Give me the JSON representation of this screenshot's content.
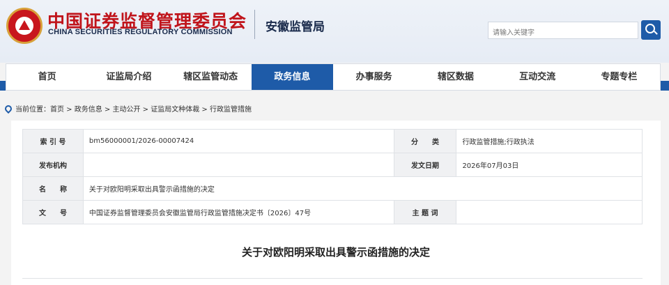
{
  "header": {
    "logo_cn": "中国证券监督管理委员会",
    "logo_en": "CHINA SECURITIES REGULATORY COMMISSION",
    "bureau": "安徽监管局",
    "search_placeholder": "请输入关键字"
  },
  "nav": {
    "items": [
      "首页",
      "证监局介绍",
      "辖区监管动态",
      "政务信息",
      "办事服务",
      "辖区数据",
      "互动交流",
      "专题专栏"
    ],
    "active": "政务信息"
  },
  "breadcrumb": "当前位置：首页 > 政务信息 > 主动公开 > 证监局文种体裁 > 行政监管措施",
  "meta": {
    "index_label": "索 引 号",
    "index_value": "bm56000001/2026-00007424",
    "category_label": "分　　类",
    "category_value": "行政监管措施;行政执法",
    "publisher_label": "发布机构",
    "publisher_value": "",
    "date_label": "发文日期",
    "date_value": "2026年07月03日",
    "name_label": "名　　称",
    "name_value": "关于对欧阳明采取出具警示函措施的决定",
    "docno_label": "文　　号",
    "docno_value": "中国证券监督管理委员会安徽监管局行政监管措施决定书〔2026〕47号",
    "subject_label": "主 题 词",
    "subject_value": ""
  },
  "document": {
    "title": "关于对欧阳明采取出具警示函措施的决定"
  },
  "colors": {
    "brand_blue": "#1e5ba8",
    "logo_red": "#c0141b"
  }
}
